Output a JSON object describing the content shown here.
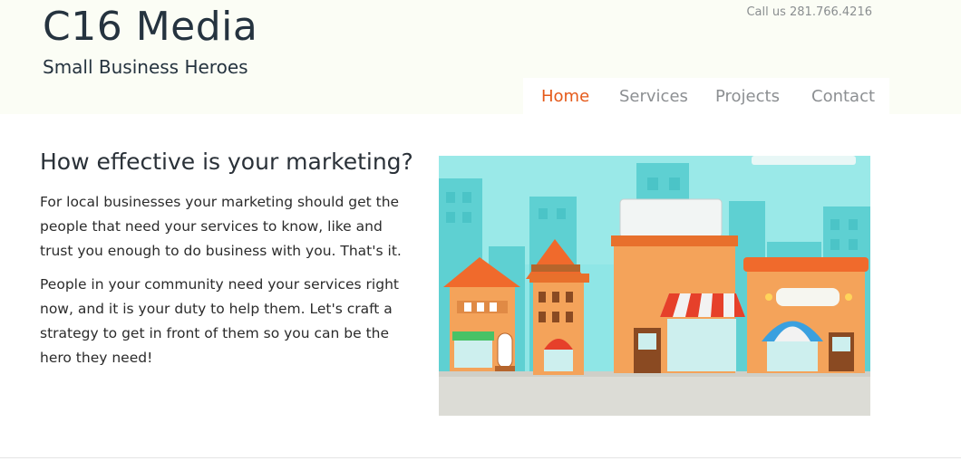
{
  "header": {
    "title": "C16 Media",
    "tagline": "Small Business Heroes",
    "phone": "Call us 281.766.4216"
  },
  "nav": {
    "items": [
      {
        "label": "Home",
        "active": true
      },
      {
        "label": "Services",
        "active": false
      },
      {
        "label": "Projects",
        "active": false
      },
      {
        "label": "Contact",
        "active": false
      }
    ]
  },
  "main": {
    "heading": "How effective is your marketing?",
    "paragraphs": [
      "For local businesses your marketing should get the people that need your services to know, like and trust you enough to do business with you. That's it.",
      "People in your community need your services right now, and it is your duty to help them. Let's craft a strategy to get in front of them so you can be the hero they need!"
    ]
  },
  "colors": {
    "header_bg": "#fbfdf5",
    "title": "#25333f",
    "nav_active": "#e55a1a",
    "nav_inactive": "#8c8f92",
    "illustration_sky": "#7fe0e0",
    "illustration_ground": "#dcdcd6"
  },
  "illustration": {
    "icon": "storefronts-illustration"
  }
}
